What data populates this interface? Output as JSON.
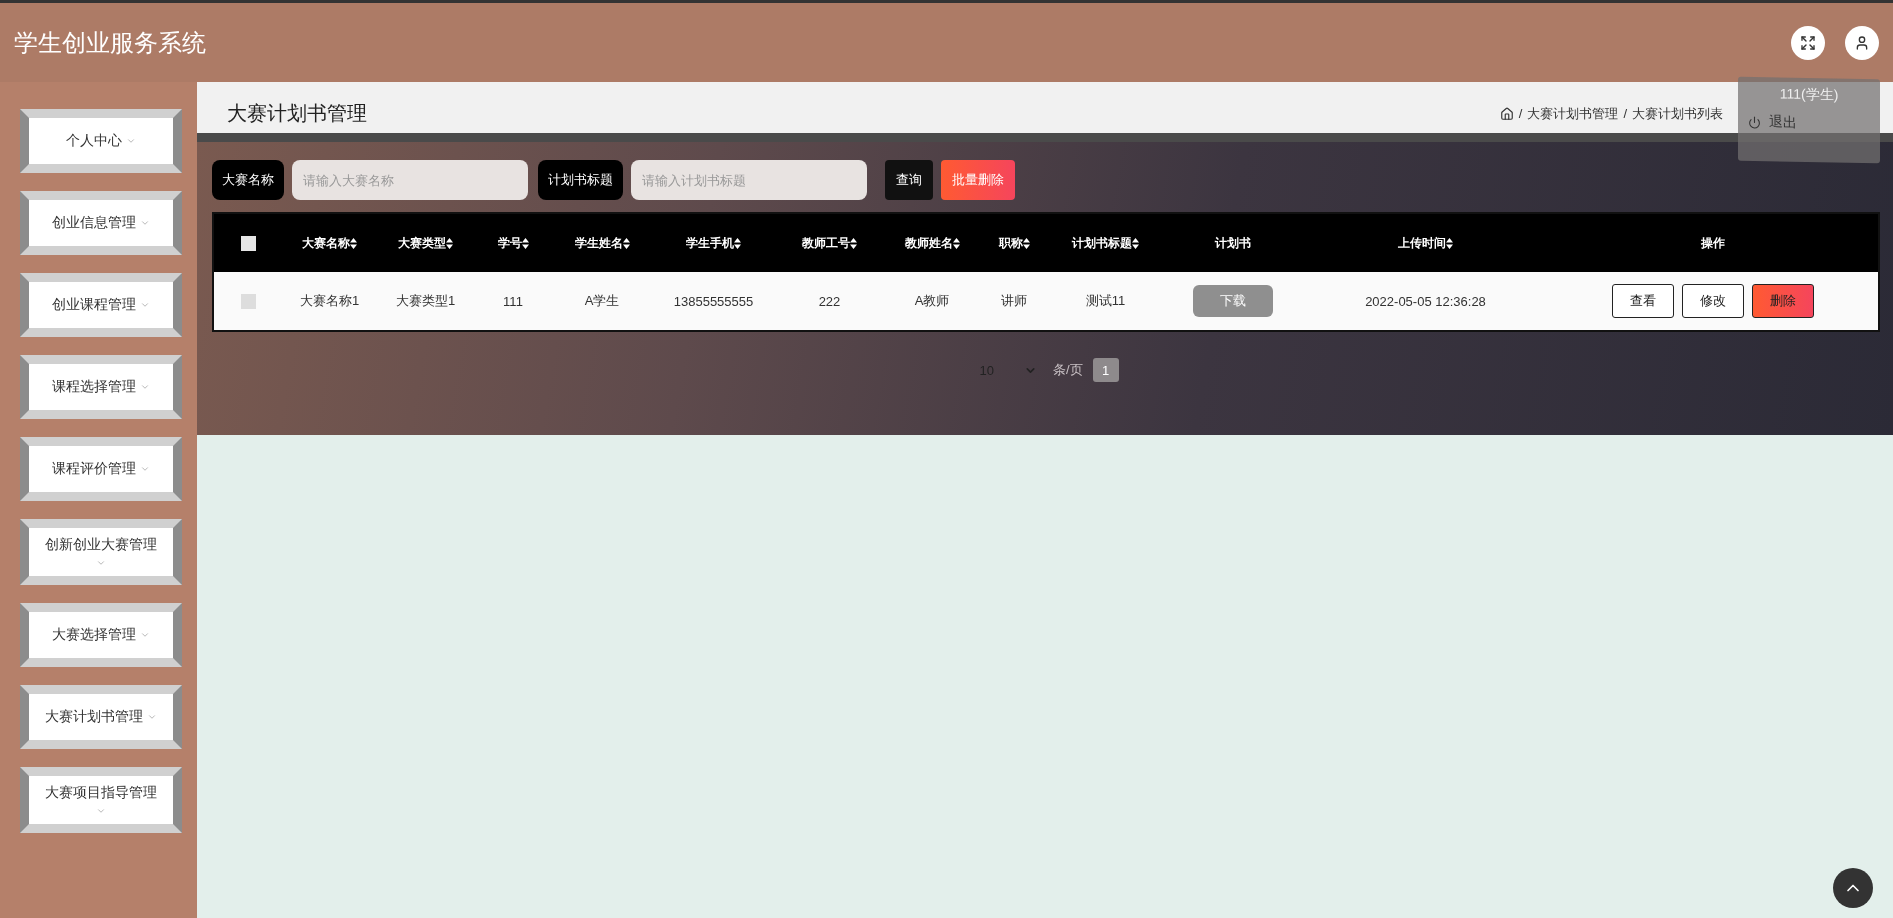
{
  "header": {
    "title": "学生创业服务系统"
  },
  "user_menu": {
    "user": "111(学生)",
    "items": [
      {
        "label": "退出"
      }
    ]
  },
  "sidebar": {
    "items": [
      {
        "label": "个人中心"
      },
      {
        "label": "创业信息管理"
      },
      {
        "label": "创业课程管理"
      },
      {
        "label": "课程选择管理"
      },
      {
        "label": "课程评价管理"
      },
      {
        "label": "创新创业大赛管理"
      },
      {
        "label": "大赛选择管理"
      },
      {
        "label": "大赛计划书管理"
      },
      {
        "label": "大赛项目指导管理"
      }
    ]
  },
  "page": {
    "title": "大赛计划书管理",
    "breadcrumb_separator": "/",
    "breadcrumb": [
      "大赛计划书管理",
      "大赛计划书列表"
    ]
  },
  "search": {
    "fields": [
      {
        "label": "大赛名称",
        "placeholder": "请输入大赛名称"
      },
      {
        "label": "计划书标题",
        "placeholder": "请输入计划书标题"
      }
    ],
    "buttons": [
      {
        "label": "查询",
        "kind": "query"
      },
      {
        "label": "批量删除",
        "kind": "danger"
      }
    ]
  },
  "table": {
    "select_all_checked": false,
    "columns": [
      {
        "label": "大赛名称",
        "sortable": true
      },
      {
        "label": "大赛类型",
        "sortable": true
      },
      {
        "label": "学号",
        "sortable": true
      },
      {
        "label": "学生姓名",
        "sortable": true
      },
      {
        "label": "学生手机",
        "sortable": true
      },
      {
        "label": "教师工号",
        "sortable": true
      },
      {
        "label": "教师姓名",
        "sortable": true
      },
      {
        "label": "职称",
        "sortable": true
      },
      {
        "label": "计划书标题",
        "sortable": true
      },
      {
        "label": "计划书",
        "sortable": false
      },
      {
        "label": "上传时间",
        "sortable": true
      },
      {
        "label": "操作",
        "sortable": false
      }
    ],
    "rows": [
      {
        "checked": false,
        "cells": [
          {
            "kind": "text",
            "text": "大赛名称1"
          },
          {
            "kind": "text",
            "text": "大赛类型1"
          },
          {
            "kind": "text",
            "text": "111"
          },
          {
            "kind": "text",
            "text": "A学生"
          },
          {
            "kind": "text",
            "text": "13855555555"
          },
          {
            "kind": "text",
            "text": "222"
          },
          {
            "kind": "text",
            "text": "A教师"
          },
          {
            "kind": "text",
            "text": "讲师"
          },
          {
            "kind": "text",
            "text": "测试11"
          },
          {
            "kind": "download",
            "text": "下载"
          },
          {
            "kind": "text",
            "text": "2022-05-05 12:36:28"
          },
          {
            "kind": "actions",
            "actions": [
              {
                "label": "查看",
                "kind": "plain"
              },
              {
                "label": "修改",
                "kind": "plain"
              },
              {
                "label": "删除",
                "kind": "danger"
              }
            ]
          }
        ]
      }
    ]
  },
  "pagination": {
    "page_size": "10",
    "page_size_label": "条/页",
    "pages": [
      {
        "label": "1",
        "selected": true
      }
    ]
  }
}
